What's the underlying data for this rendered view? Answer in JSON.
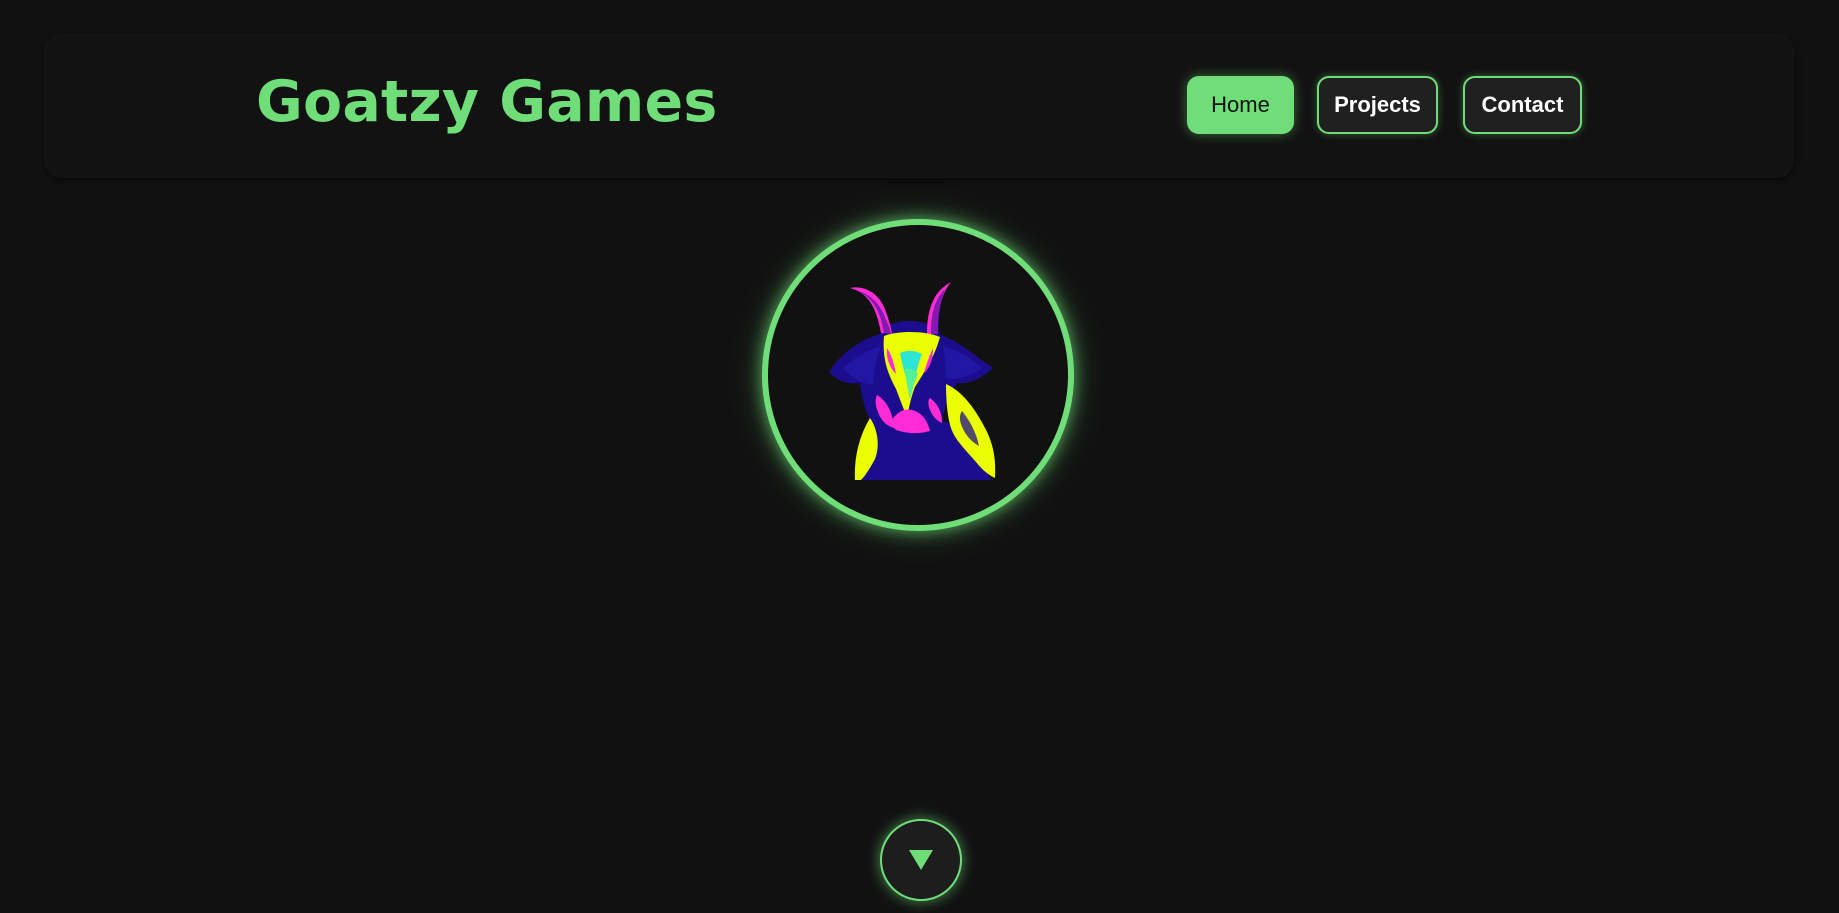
{
  "header": {
    "brand": "Goatzy Games",
    "nav": {
      "home_label": "Home",
      "projects_label": "Projects",
      "contact_label": "Contact"
    }
  },
  "hero": {
    "logo_icon": "goat-icon",
    "scroll_icon": "triangle-down-icon"
  },
  "colors": {
    "background": "#111111",
    "accent": "#6fde78",
    "panel": "#121212",
    "button_dark": "#202020",
    "goat_yellow": "#eaff00",
    "goat_blue": "#1c0d8f",
    "goat_magenta": "#ff2bd5",
    "goat_cyan": "#2ce6d3"
  }
}
